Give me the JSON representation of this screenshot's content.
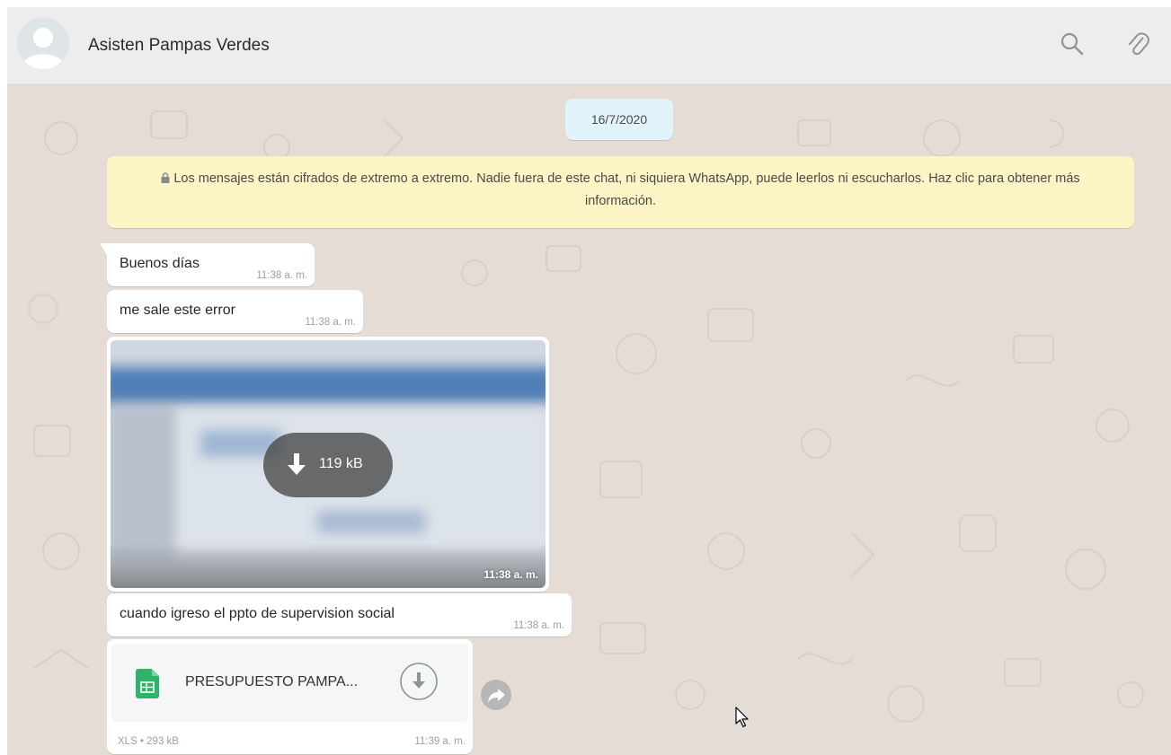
{
  "chat": {
    "contact_name": "Asisten Pampas Verdes"
  },
  "colors": {
    "chat_background": "#e5ddd5",
    "date_chip": "#e1f3fb",
    "notice": "#fcf4c4",
    "xls_green": "#2fb36a"
  },
  "header_icons": [
    "search-icon",
    "attach-icon"
  ],
  "date_separator": "16/7/2020",
  "encryption_notice": "Los mensajes están cifrados de extremo a extremo. Nadie fuera de este chat, ni siquiera WhatsApp, puede leerlos ni escucharlos. Haz clic para obtener más información.",
  "messages": [
    {
      "text": "Buenos días",
      "time": "11:38 a. m."
    },
    {
      "text": "me sale este error",
      "time": "11:38 a. m."
    },
    {
      "text": "cuando igreso el ppto de supervision social",
      "time": "11:38 a. m."
    }
  ],
  "image_message": {
    "download_label": "119 kB",
    "time": "11:38 a. m."
  },
  "document_message": {
    "filename": "PRESUPUESTO PAMPA...",
    "meta": "XLS • 293 kB",
    "time": "11:39 a. m."
  }
}
